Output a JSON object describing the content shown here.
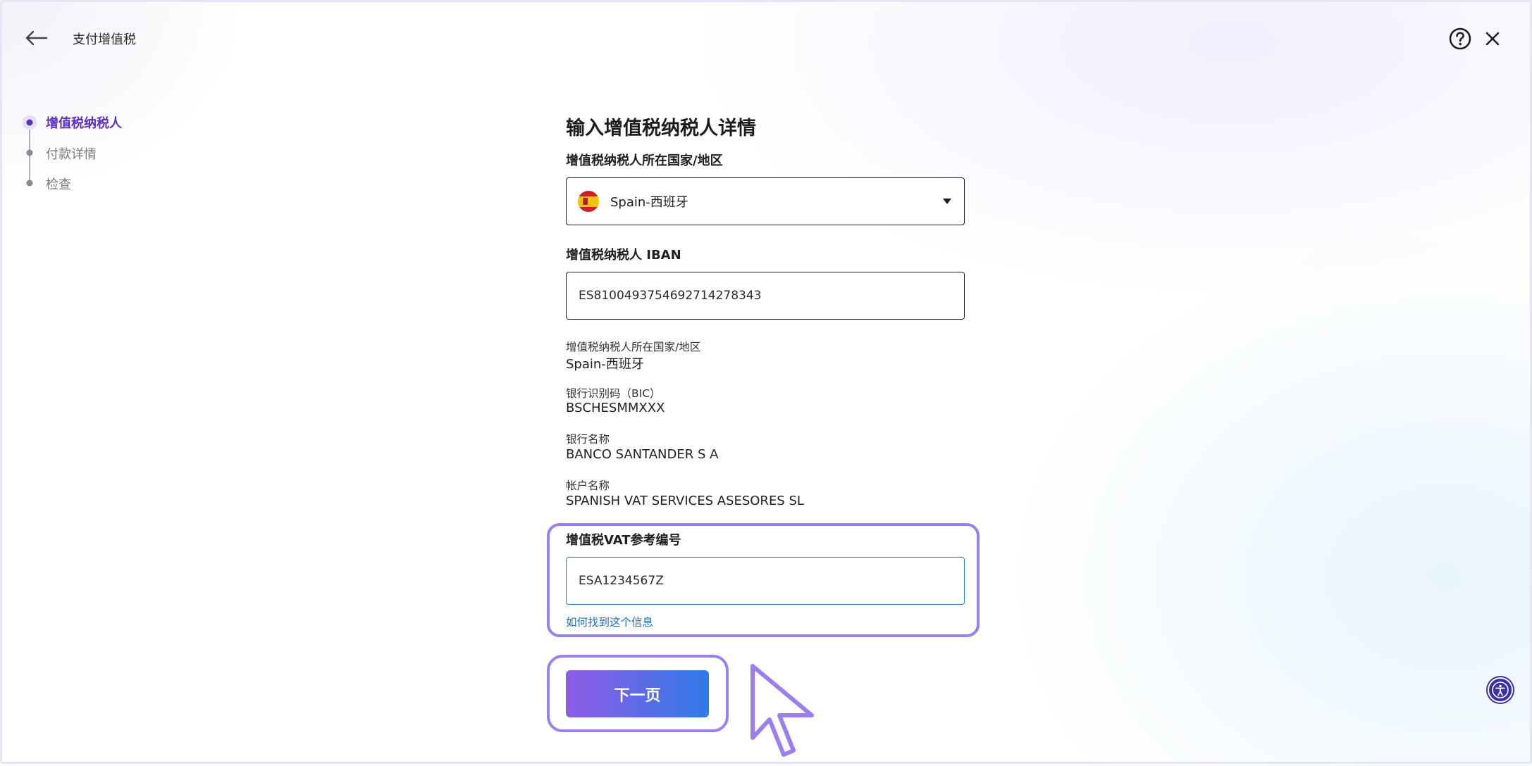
{
  "header": {
    "title": "支付增值税",
    "back_icon": "arrow-left-icon",
    "help_icon": "question-circle-icon",
    "close_icon": "close-icon"
  },
  "stepper": {
    "steps": [
      {
        "label": "增值税纳税人",
        "state": "active"
      },
      {
        "label": "付款详情",
        "state": "pending"
      },
      {
        "label": "检查",
        "state": "pending"
      }
    ],
    "active_color": "#5a2fc2"
  },
  "form": {
    "title": "输入增值税纳税人详情",
    "country_label": "增值税纳税人所在国家/地区",
    "country_value": "Spain-西班牙",
    "country_flag": "spain-flag-icon",
    "iban_label": "增值税纳税人 IBAN",
    "iban_value": "ES8100493754692714278343",
    "info": [
      {
        "label": "增值税纳税人所在国家/地区",
        "value": "Spain-西班牙"
      },
      {
        "label": "银行识别码（BIC）",
        "value": "BSCHESMMXXX"
      },
      {
        "label": "银行名称",
        "value": "BANCO SANTANDER S A"
      },
      {
        "label": "帐户名称",
        "value": "SPANISH VAT SERVICES ASESORES SL"
      }
    ],
    "vat_ref_label": "增值税VAT参考编号",
    "vat_ref_value": "ESA1234567Z",
    "help_link": "如何找到这个信息",
    "next_button": "下一页"
  },
  "colors": {
    "highlight": "#9b7ff0",
    "link": "#1b6fc0",
    "focus_border": "#2b7bc8",
    "button_gradient_start": "#8f5ce6",
    "button_gradient_end": "#2f7ae8",
    "accessibility_bg": "#3a2fa6"
  },
  "accessibility_icon": "accessibility-icon"
}
